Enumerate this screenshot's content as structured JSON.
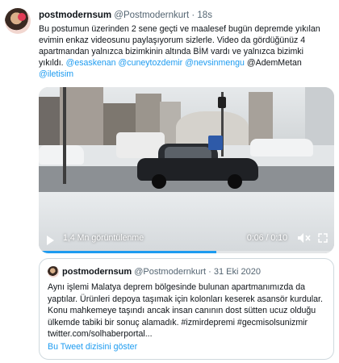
{
  "tweet": {
    "display_name": "postmodernsum",
    "handle": "@Postmodernkurt",
    "separator": "·",
    "time": "18s",
    "text": "Bu postumun üzerinden 2 sene geçti ve maalesef bugün depremde yıkılan evimin enkaz videosunu paylaşıyorum sizlerle. Video da gördüğünüz 4 apartmandan yalnızca bizimkinin altında BİM vardı ve yalnızca bizimki yıkıldı.",
    "mentions": [
      "@esaskenan",
      "@cuneytozdemir",
      "@nevsinmengu"
    ],
    "plain_tag": "@AdemMetan",
    "last_mention": "@iletisim"
  },
  "video": {
    "views": "1,4 Mn görüntülenme",
    "duration": "0:06 / 0:10",
    "progress_fraction": 0.6,
    "icons": [
      "play-icon",
      "mute-icon",
      "expand-icon"
    ],
    "accent": "#1d9bf0"
  },
  "quote": {
    "display_name": "postmodernsum",
    "handle": "@Postmodernkurt",
    "separator": "·",
    "date": "31 Eki 2020",
    "text": "Aynı işlemi Malatya deprem bölgesinde bulunan apartmanımızda da yaptılar. Ürünleri depoya taşımak için kolonları keserek asansör kurdular. Konu mahkemeye taşındı ancak insan canının dost sütten ucuz olduğu ülkemde tabiki bir sonuç alamadık. #izmirdepremi #gecmisolsunizmir twitter.com/solhaberportal...",
    "thread_link": "Bu Tweet dizisini göster"
  }
}
